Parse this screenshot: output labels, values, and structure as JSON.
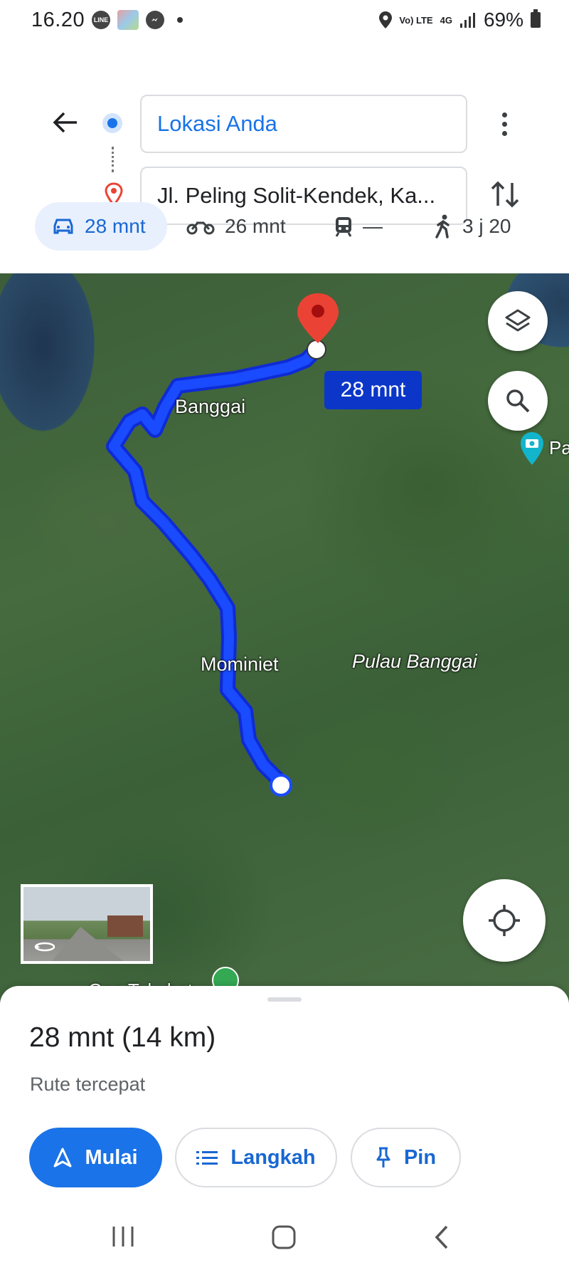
{
  "status_bar": {
    "time": "16.20",
    "app_icons": [
      "line-icon",
      "gallery-icon",
      "messenger-icon"
    ],
    "network_label_top": "Vo) LTE",
    "network_label_4g": "4G",
    "battery": "69%"
  },
  "directions": {
    "origin": "Lokasi Anda",
    "destination": "Jl. Peling Solit-Kendek, Ka..."
  },
  "modes": [
    {
      "name": "car",
      "label": "28 mnt",
      "active": true
    },
    {
      "name": "motorcycle",
      "label": "26 mnt",
      "active": false
    },
    {
      "name": "transit",
      "label": "—",
      "active": false
    },
    {
      "name": "walk",
      "label": "3 j 20",
      "active": false
    }
  ],
  "map": {
    "eta_chip": "28 mnt",
    "labels": {
      "banggai": "Banggai",
      "mominiet": "Mominiet",
      "pulau": "Pulau Banggai",
      "poi_partial": "Pa",
      "bottom_poi": "Goa Takubat"
    }
  },
  "sheet": {
    "summary": "28 mnt (14 km)",
    "note": "Rute tercepat",
    "buttons": {
      "start": "Mulai",
      "steps": "Langkah",
      "pin": "Pin"
    }
  },
  "colors": {
    "accent": "#1a73e8",
    "route": "#1a4bff",
    "eta_chip": "#0b36c8",
    "destination_pin": "#ea4335"
  }
}
